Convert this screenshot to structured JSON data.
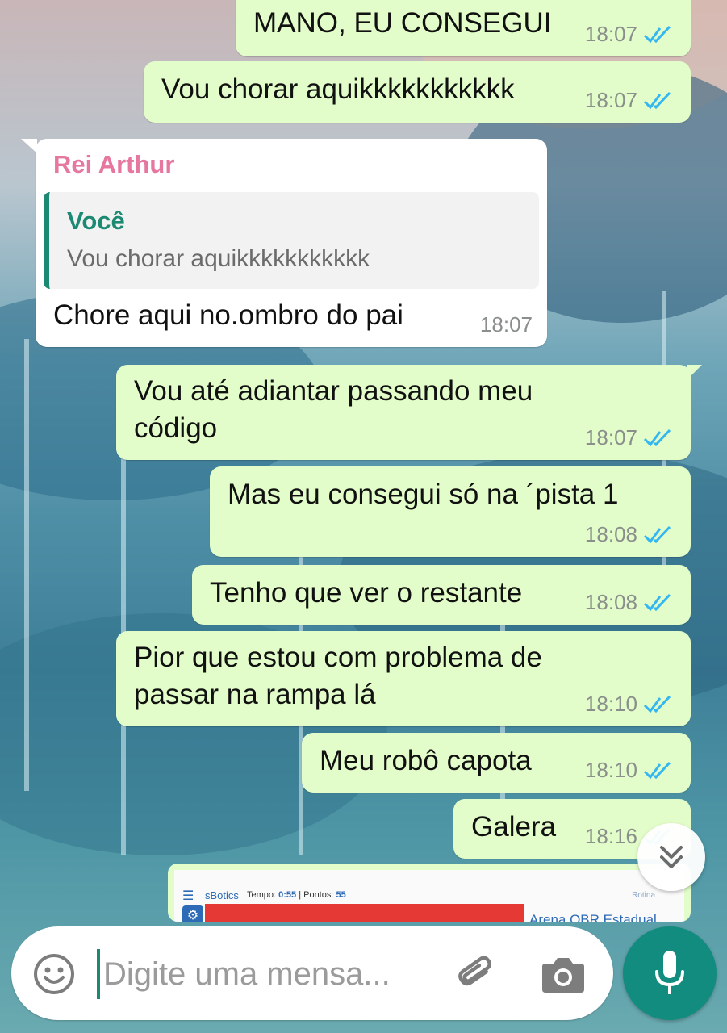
{
  "messages": [
    {
      "text": "MANO, EU CONSEGUI",
      "time": "18:07"
    },
    {
      "text": "Vou chorar aquikkkkkkkkkkk",
      "time": "18:07"
    },
    {
      "sender": "Rei Arthur",
      "quote_author": "Você",
      "quote_text": "Vou chorar aquikkkkkkkkkkk",
      "text": "Chore aqui no.ombro do pai",
      "time": "18:07"
    },
    {
      "line1": "Vou até adiantar passando meu",
      "line2": "código",
      "time": "18:07"
    },
    {
      "text": "Mas eu consegui só na ´pista 1",
      "time": "18:08"
    },
    {
      "text": "Tenho que ver o restante",
      "time": "18:08"
    },
    {
      "line1": "Pior que estou com problema de",
      "line2": "passar na rampa lá",
      "time": "18:10"
    },
    {
      "text": "Meu robô capota",
      "time": "18:10"
    },
    {
      "text": "Galera",
      "time": "18:16"
    }
  ],
  "preview": {
    "app": "sBotics",
    "tempo_label": "Tempo:",
    "tempo_value": "0:55",
    "pontos_label": "| Pontos:",
    "pontos_value": "55",
    "rotina": "Rotina",
    "stage": "Arena OBR Estadual"
  },
  "composer": {
    "placeholder": "Digite uma mensa..."
  },
  "colors": {
    "outgoing_bubble": "#e2fdc9",
    "incoming_bubble": "#ffffff",
    "read_ticks": "#34b7f1",
    "accent": "#128c7e",
    "sender_name": "#e6779f",
    "quote_author": "#1c8a72"
  },
  "icons": [
    "double-check-icon",
    "chevron-double-down-icon",
    "emoji-icon",
    "paperclip-icon",
    "camera-icon",
    "microphone-icon"
  ]
}
